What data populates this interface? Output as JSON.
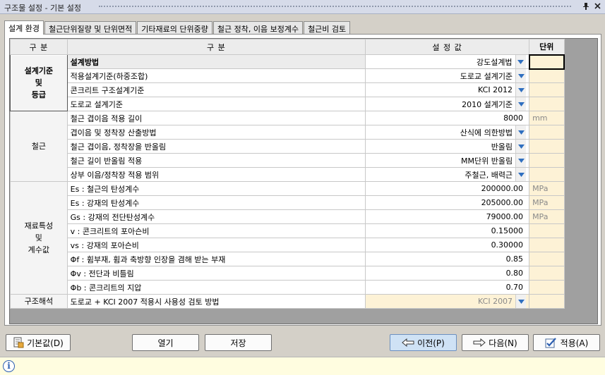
{
  "window": {
    "title": "구조물 설정 - 기본 설정",
    "pin_icon": "pin-icon",
    "close_icon": "close-icon"
  },
  "tabs": [
    {
      "label": "설계 환경",
      "active": true
    },
    {
      "label": "철근단위질량 및 단위면적",
      "active": false
    },
    {
      "label": "기타재료의 단위중량",
      "active": false
    },
    {
      "label": "철근 정착, 이음 보정계수",
      "active": false
    },
    {
      "label": "철근비 검토",
      "active": false
    }
  ],
  "grid": {
    "headers": {
      "group": "구  분",
      "label": "구  분",
      "value": "설 정 값",
      "unit": "단위"
    },
    "groups": {
      "design": "설계기준\n및\n등급",
      "rebar": "철근",
      "material": "재료특성\n및\n계수값",
      "analysis": "구조해석"
    },
    "rows": [
      {
        "label": "설계방법",
        "value": "강도설계법",
        "unit": "",
        "dropdown": true
      },
      {
        "label": "적용설계기준(하중조합)",
        "value": "도로교 설계기준",
        "unit": "",
        "dropdown": true
      },
      {
        "label": "콘크리트 구조설계기준",
        "value": "KCI 2012",
        "unit": "",
        "dropdown": true
      },
      {
        "label": "도로교 설계기준",
        "value": "2010 설계기준",
        "unit": "",
        "dropdown": true
      },
      {
        "label": "철근 겹이음 적용 길이",
        "value": "8000",
        "unit": "mm",
        "dropdown": false
      },
      {
        "label": "겹이음 및 정착장 산출방법",
        "value": "산식에 의한방법",
        "unit": "",
        "dropdown": true
      },
      {
        "label": "철근 겹이음, 정착장을 반올림",
        "value": "반올림",
        "unit": "",
        "dropdown": true
      },
      {
        "label": "철근 길이 반올림 적용",
        "value": "MM단위 반올림",
        "unit": "",
        "dropdown": true
      },
      {
        "label": "상부 이음/정착장 적용 범위",
        "value": "주철근, 배력근",
        "unit": "",
        "dropdown": true
      },
      {
        "label": "Es : 철근의 탄성계수",
        "value": "200000.00",
        "unit": "MPa",
        "dropdown": false
      },
      {
        "label": "Es : 강재의 탄성계수",
        "value": "205000.00",
        "unit": "MPa",
        "dropdown": false
      },
      {
        "label": "Gs : 강재의 전단탄성계수",
        "value": "79000.00",
        "unit": "MPa",
        "dropdown": false
      },
      {
        "label": "v : 콘크리트의 포아슨비",
        "value": "0.15000",
        "unit": "",
        "dropdown": false
      },
      {
        "label": "vs : 강재의 포아슨비",
        "value": "0.30000",
        "unit": "",
        "dropdown": false
      },
      {
        "label": "Φf : 휨부재, 휨과 축방향 인장을 겸해 받는 부재",
        "value": "0.85",
        "unit": "",
        "dropdown": false
      },
      {
        "label": "Φv : 전단과 비틀림",
        "value": "0.80",
        "unit": "",
        "dropdown": false
      },
      {
        "label": "Φb : 콘크리트의 지압",
        "value": "0.70",
        "unit": "",
        "dropdown": false
      },
      {
        "label": "도로교 + KCI 2007 적용시 사용성 검토 방법",
        "value": "KCI 2007",
        "unit": "",
        "dropdown": true,
        "disabled": true
      }
    ]
  },
  "buttons": {
    "defaults": "기본값(D)",
    "open": "열기",
    "save": "저장",
    "prev": "이전(P)",
    "next": "다음(N)",
    "apply": "적용(A)"
  },
  "status": {
    "icon": "info-icon"
  },
  "colors": {
    "accent": "#2d5fb0",
    "dropdown_arrow": "#2f6fc0",
    "unit_bg": "#fdf2d6"
  }
}
